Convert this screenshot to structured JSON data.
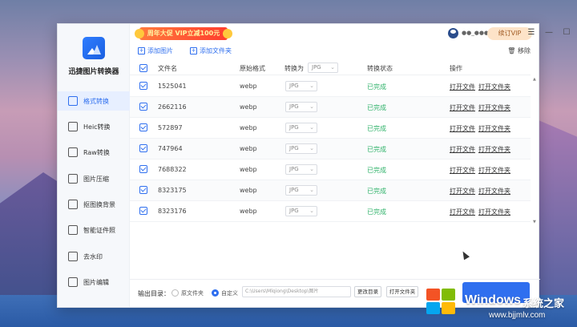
{
  "app": {
    "name": "迅捷图片转换器"
  },
  "titlebar": {
    "promo": "周年大促 VIP立减100元",
    "user_id": "●●_●●●●",
    "vip_button": "续订VIP",
    "menu_icon": "☰",
    "minimize_icon": "—",
    "maximize_icon": "☐",
    "close_icon": "✕"
  },
  "sidebar": {
    "items": [
      {
        "label": "格式转换",
        "icon": "format-convert-icon",
        "active": true
      },
      {
        "label": "Heic转换",
        "icon": "heic-icon",
        "active": false
      },
      {
        "label": "Raw转换",
        "icon": "raw-icon",
        "active": false
      },
      {
        "label": "图片压缩",
        "icon": "compress-icon",
        "active": false
      },
      {
        "label": "抠图换背景",
        "icon": "cutout-icon",
        "active": false
      },
      {
        "label": "智能证件照",
        "icon": "id-photo-icon",
        "active": false
      },
      {
        "label": "去水印",
        "icon": "watermark-icon",
        "active": false
      },
      {
        "label": "图片编辑",
        "icon": "edit-icon",
        "active": false
      }
    ]
  },
  "toolbar": {
    "add_image": "添加图片",
    "add_folder": "添加文件夹",
    "remove": "移除"
  },
  "table": {
    "headers": {
      "filename": "文件名",
      "original_format": "原始格式",
      "convert_to": "转换为",
      "convert_to_value": "JPG",
      "status": "转换状态",
      "action": "操作"
    },
    "rows": [
      {
        "name": "1525041",
        "format": "webp",
        "target": "JPG",
        "status": "已完成",
        "open_file": "打开文件",
        "open_folder": "打开文件夹"
      },
      {
        "name": "2662116",
        "format": "webp",
        "target": "JPG",
        "status": "已完成",
        "open_file": "打开文件",
        "open_folder": "打开文件夹"
      },
      {
        "name": "572897",
        "format": "webp",
        "target": "JPG",
        "status": "已完成",
        "open_file": "打开文件",
        "open_folder": "打开文件夹"
      },
      {
        "name": "747964",
        "format": "webp",
        "target": "JPG",
        "status": "已完成",
        "open_file": "打开文件",
        "open_folder": "打开文件夹"
      },
      {
        "name": "7688322",
        "format": "webp",
        "target": "JPG",
        "status": "已完成",
        "open_file": "打开文件",
        "open_folder": "打开文件夹"
      },
      {
        "name": "8323175",
        "format": "webp",
        "target": "JPG",
        "status": "已完成",
        "open_file": "打开文件",
        "open_folder": "打开文件夹"
      },
      {
        "name": "8323176",
        "format": "webp",
        "target": "JPG",
        "status": "已完成",
        "open_file": "打开文件",
        "open_folder": "打开文件夹"
      }
    ]
  },
  "footer": {
    "output_label": "输出目录：",
    "option_original": "原文件夹",
    "option_custom": "自定义",
    "path": "C:\\Users\\Mlqiong\\Desktop\\图片",
    "change_dir": "更改目录",
    "open_folder": "打开文件夹"
  },
  "watermark": {
    "title": "Windows",
    "cn": "系统之家",
    "url": "www.bjjmlv.com"
  },
  "colors": {
    "accent": "#2f6fef",
    "status_done": "#31b36b",
    "promo": "#ff3d2e",
    "vip": "#fde3c8"
  }
}
